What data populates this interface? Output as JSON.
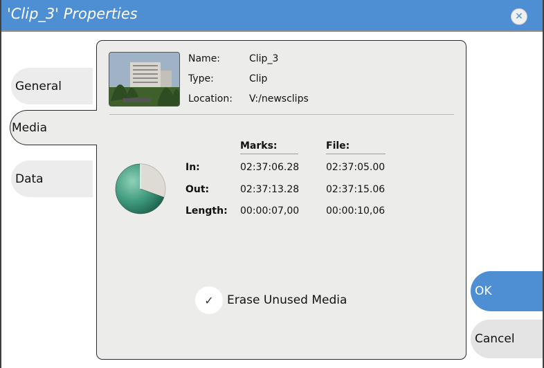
{
  "window": {
    "title": "'Clip_3' Properties",
    "close_icon": "close-icon",
    "accent_color": "#4d8fd2"
  },
  "tabs": [
    {
      "label": "General",
      "selected": false
    },
    {
      "label": "Media",
      "selected": true
    },
    {
      "label": "Data",
      "selected": false
    }
  ],
  "clip_info": {
    "thumbnail_caption": "clip thumbnail",
    "name_label": "Name:",
    "name_value": "Clip_3",
    "type_label": "Type:",
    "type_value": "Clip",
    "location_label": "Location:",
    "location_value": "V:/newsclips"
  },
  "timecodes": {
    "marks_header": "Marks:",
    "file_header": "File:",
    "rows": [
      {
        "label": "In:",
        "marks": "02:37:06.28",
        "file": "02:37:05.00"
      },
      {
        "label": "Out:",
        "marks": "02:37:13.28",
        "file": "02:37:15.06"
      },
      {
        "label": "Length:",
        "marks": "00:00:07,00",
        "file": "00:00:10,06"
      }
    ],
    "used_fraction": 0.695
  },
  "options": {
    "erase_unused_label": "Erase Unused Media",
    "erase_unused_checked": true
  },
  "buttons": {
    "ok_label": "OK",
    "cancel_label": "Cancel"
  }
}
